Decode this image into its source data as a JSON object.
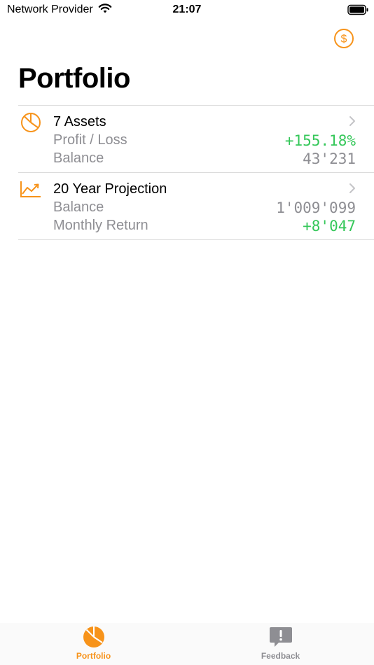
{
  "status_bar": {
    "carrier": "Network Provider",
    "time": "21:07"
  },
  "header": {
    "title": "Portfolio",
    "currency_icon": "dollar-circle-icon"
  },
  "colors": {
    "accent": "#f7931a",
    "positive": "#34c759",
    "secondary_text": "#8e8e93"
  },
  "list": {
    "assets": {
      "title": "7 Assets",
      "icon": "pie-chart-icon",
      "line1_label": "Profit / Loss",
      "line1_value": "+155.18%",
      "line2_label": "Balance",
      "line2_value": "43'231"
    },
    "projection": {
      "title": "20 Year Projection",
      "icon": "trend-up-icon",
      "line1_label": "Balance",
      "line1_value": "1'009'099",
      "line2_label": "Monthly Return",
      "line2_value": "+8'047"
    }
  },
  "tab_bar": {
    "tabs": [
      {
        "label": "Portfolio",
        "icon": "pie-chart-tab-icon",
        "active": true
      },
      {
        "label": "Feedback",
        "icon": "feedback-bubble-icon",
        "active": false
      }
    ]
  }
}
